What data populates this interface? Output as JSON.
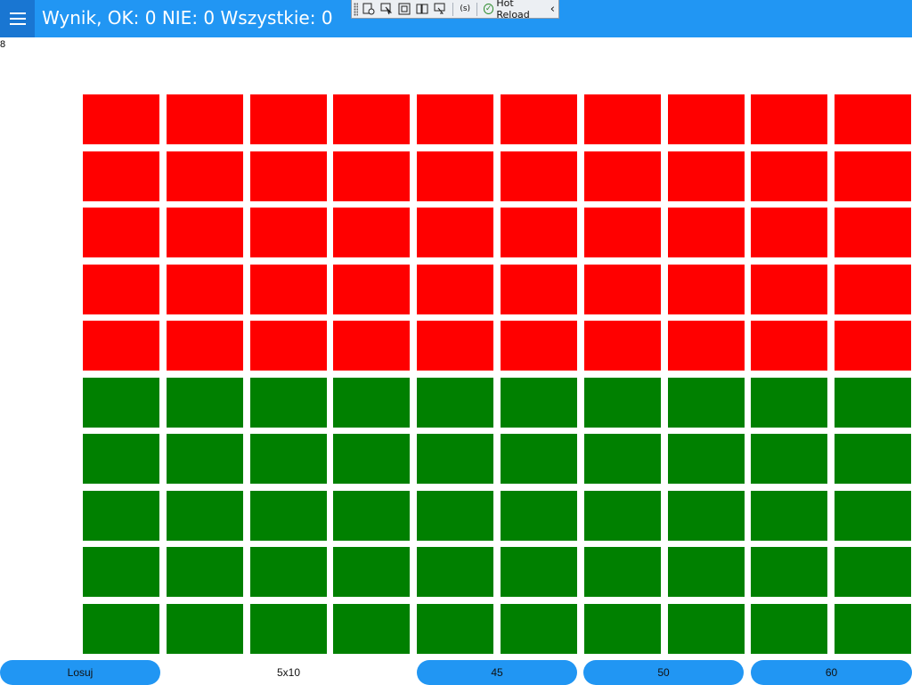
{
  "header": {
    "title": "Wynik, OK: 0 NIE: 0 Wszystkie: 0",
    "menu_icon": "hamburger-icon",
    "accent_color": "#2196f3"
  },
  "dev_toolbar": {
    "tools": [
      {
        "name": "live-visual-tree-icon"
      },
      {
        "name": "select-element-icon"
      },
      {
        "name": "display-layout-adorners-icon"
      },
      {
        "name": "track-focused-element-icon"
      },
      {
        "name": "bind-failures-icon"
      }
    ],
    "sync_label": "(s)",
    "hot_reload_label": "Hot Reload",
    "collapse_icon": "chevron-left-icon"
  },
  "counter": {
    "value": "8"
  },
  "board": {
    "columns": 10,
    "rows": [
      {
        "color": "#ff0000"
      },
      {
        "color": "#ff0000"
      },
      {
        "color": "#ff0000"
      },
      {
        "color": "#ff0000"
      },
      {
        "color": "#ff0000"
      },
      {
        "color": "#008000"
      },
      {
        "color": "#008000"
      },
      {
        "color": "#008000"
      },
      {
        "color": "#008000"
      },
      {
        "color": "#008000"
      }
    ]
  },
  "bottom_bar": {
    "draw_button": "Losuj",
    "size_label": "5x10",
    "option_buttons": [
      "45",
      "50",
      "60"
    ]
  }
}
